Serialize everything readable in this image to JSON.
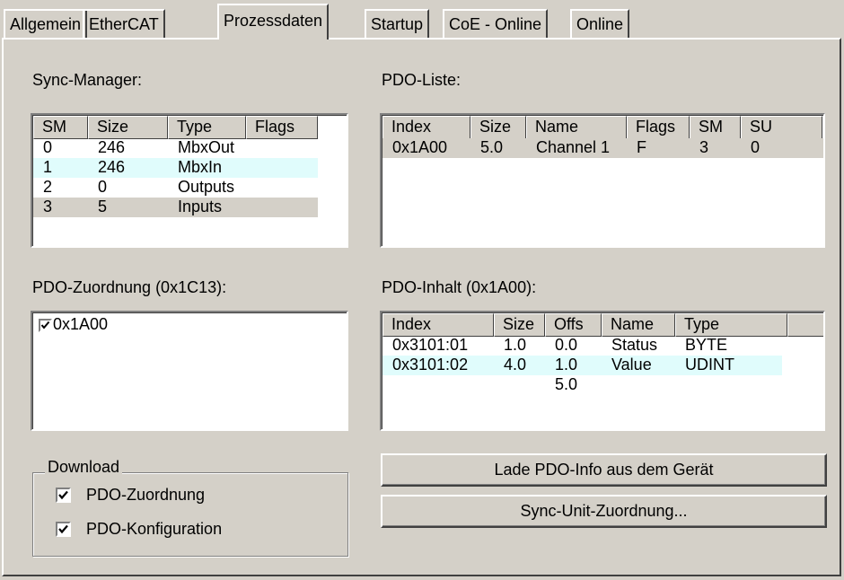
{
  "tabs": [
    "Allgemein",
    "EtherCAT",
    "Prozessdaten",
    "Startup",
    "CoE - Online",
    "Online"
  ],
  "sync_manager": {
    "label": "Sync-Manager:",
    "columns": [
      "SM",
      "Size",
      "Type",
      "Flags"
    ],
    "rows": [
      [
        "0",
        "246",
        "MbxOut",
        ""
      ],
      [
        "1",
        "246",
        "MbxIn",
        ""
      ],
      [
        "2",
        "0",
        "Outputs",
        ""
      ],
      [
        "3",
        "5",
        "Inputs",
        ""
      ]
    ]
  },
  "pdo_liste": {
    "label": "PDO-Liste:",
    "columns": [
      "Index",
      "Size",
      "Name",
      "Flags",
      "SM",
      "SU"
    ],
    "rows": [
      [
        "0x1A00",
        "5.0",
        "Channel 1",
        "F",
        "3",
        "0"
      ]
    ]
  },
  "pdo_zuordnung": {
    "label": "PDO-Zuordnung (0x1C13):",
    "items": [
      {
        "label": "0x1A00",
        "checked": true
      }
    ]
  },
  "pdo_inhalt": {
    "label": "PDO-Inhalt (0x1A00):",
    "columns": [
      "Index",
      "Size",
      "Offs",
      "Name",
      "Type"
    ],
    "rows": [
      [
        "0x3101:01",
        "1.0",
        "0.0",
        "Status",
        "BYTE"
      ],
      [
        "0x3101:02",
        "4.0",
        "1.0",
        "Value",
        "UDINT"
      ],
      [
        "",
        "",
        "5.0",
        "",
        ""
      ]
    ]
  },
  "download": {
    "label": "Download",
    "options": [
      {
        "label": "PDO-Zuordnung",
        "checked": true
      },
      {
        "label": "PDO-Konfiguration",
        "checked": true
      }
    ]
  },
  "buttons": {
    "load_pdo_info": "Lade PDO-Info aus dem Gerät",
    "sync_unit": "Sync-Unit-Zuordnung..."
  }
}
